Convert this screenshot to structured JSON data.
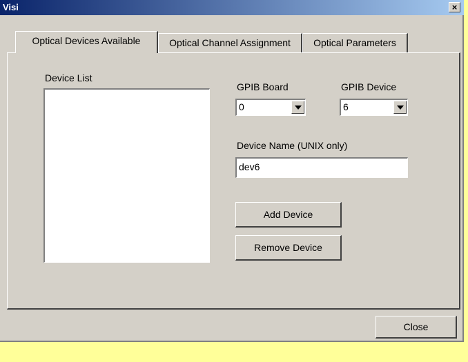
{
  "window": {
    "title": "Visi",
    "close_glyph": "×"
  },
  "tabs": [
    {
      "label": "Optical Devices Available",
      "active": true
    },
    {
      "label": "Optical Channel Assignment",
      "active": false
    },
    {
      "label": "Optical Parameters",
      "active": false
    }
  ],
  "device_list": {
    "label": "Device List",
    "items": []
  },
  "gpib_board": {
    "label": "GPIB Board",
    "value": "0"
  },
  "gpib_device": {
    "label": "GPIB Device",
    "value": "6"
  },
  "device_name": {
    "label": "Device Name (UNIX only)",
    "value": "dev6"
  },
  "buttons": {
    "add": "Add Device",
    "remove": "Remove Device",
    "close": "Close"
  },
  "colors": {
    "desktop": "#ffff99",
    "face": "#d4d0c8",
    "title_start": "#0a246a",
    "title_end": "#a6caf0"
  }
}
